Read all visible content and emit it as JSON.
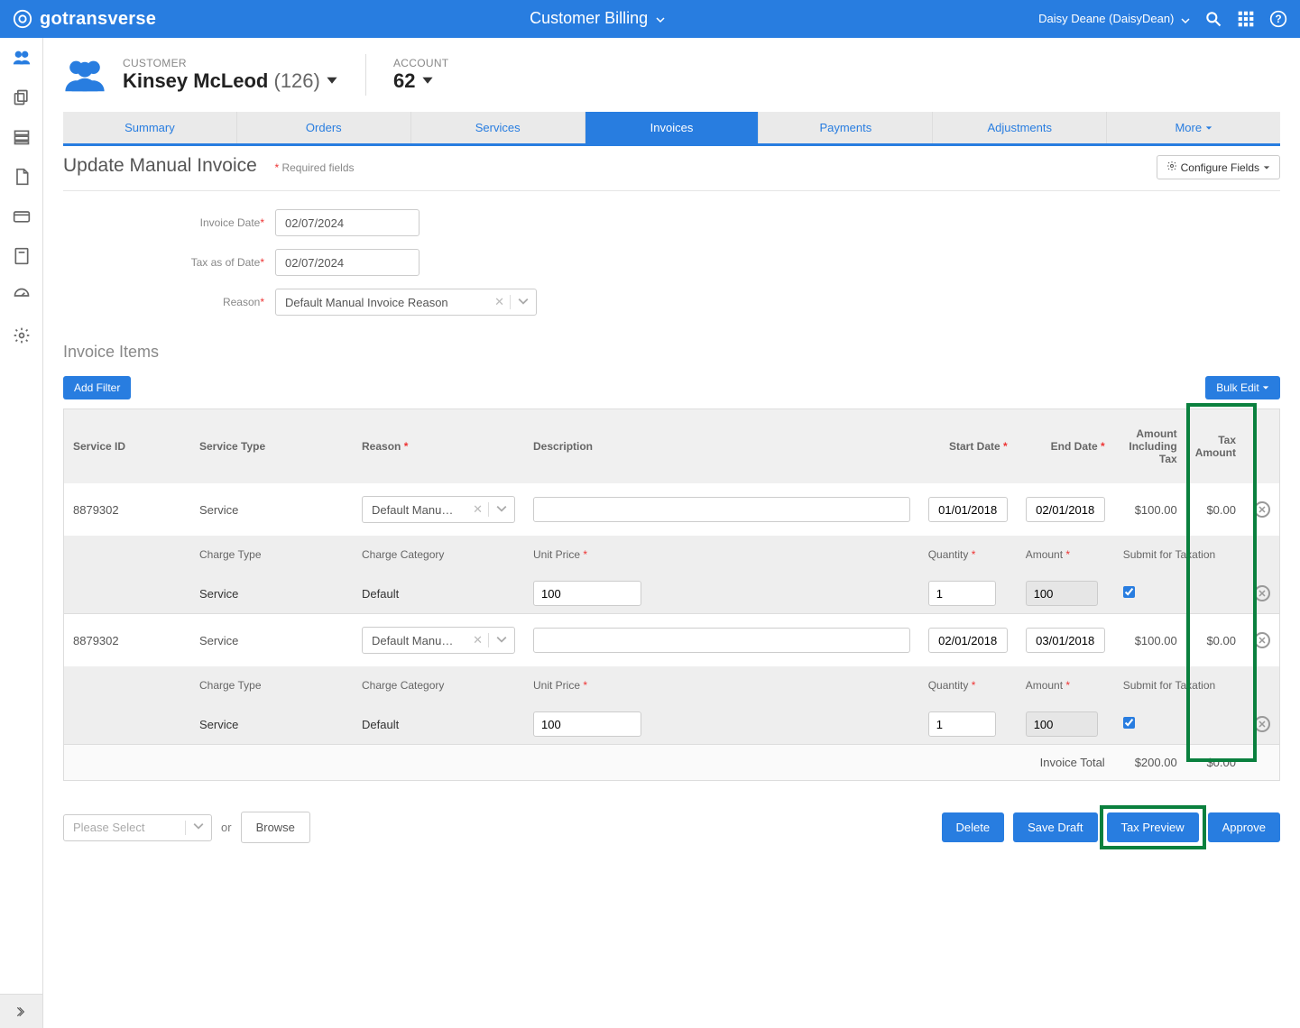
{
  "brand": "gotransverse",
  "topbar": {
    "center": "Customer Billing",
    "user": "Daisy Deane (DaisyDean)"
  },
  "customer": {
    "label": "CUSTOMER",
    "name": "Kinsey McLeod",
    "id_display": "(126)"
  },
  "account": {
    "label": "ACCOUNT",
    "number": "62"
  },
  "tabs": [
    "Summary",
    "Orders",
    "Services",
    "Invoices",
    "Payments",
    "Adjustments",
    "More"
  ],
  "active_tab": "Invoices",
  "page": {
    "title": "Update Manual Invoice",
    "required_note": "Required fields",
    "configure_btn": "Configure Fields"
  },
  "form": {
    "invoice_date_label": "Invoice Date",
    "invoice_date": "02/07/2024",
    "tax_date_label": "Tax as of Date",
    "tax_date": "02/07/2024",
    "reason_label": "Reason",
    "reason_value": "Default Manual Invoice Reason"
  },
  "items_section": {
    "title": "Invoice Items",
    "add_filter": "Add Filter",
    "bulk_edit": "Bulk Edit"
  },
  "columns": {
    "service_id": "Service ID",
    "service_type": "Service Type",
    "reason": "Reason",
    "description": "Description",
    "start_date": "Start Date",
    "end_date": "End Date",
    "amount_incl_tax": "Amount Including Tax",
    "tax_amount": "Tax Amount",
    "charge_type": "Charge Type",
    "charge_category": "Charge Category",
    "unit_price": "Unit Price",
    "quantity": "Quantity",
    "amount": "Amount",
    "submit_tax": "Submit for Taxation"
  },
  "rows": [
    {
      "service_id": "8879302",
      "service_type": "Service",
      "reason": "Default Manual I...",
      "description": "",
      "start": "01/01/2018",
      "end": "02/01/2018",
      "amount_incl_tax": "$100.00",
      "tax_amount": "$0.00",
      "charge_type": "Service",
      "charge_category": "Default",
      "unit_price": "100",
      "quantity": "1",
      "amount": "100",
      "submit": true
    },
    {
      "service_id": "8879302",
      "service_type": "Service",
      "reason": "Default Manual I...",
      "description": "",
      "start": "02/01/2018",
      "end": "03/01/2018",
      "amount_incl_tax": "$100.00",
      "tax_amount": "$0.00",
      "charge_type": "Service",
      "charge_category": "Default",
      "unit_price": "100",
      "quantity": "1",
      "amount": "100",
      "submit": true
    }
  ],
  "totals": {
    "label": "Invoice Total",
    "amount": "$200.00",
    "tax": "$0.00"
  },
  "bottom": {
    "please_select": "Please Select",
    "or": "or",
    "browse": "Browse",
    "delete": "Delete",
    "save_draft": "Save Draft",
    "tax_preview": "Tax Preview",
    "approve": "Approve"
  }
}
